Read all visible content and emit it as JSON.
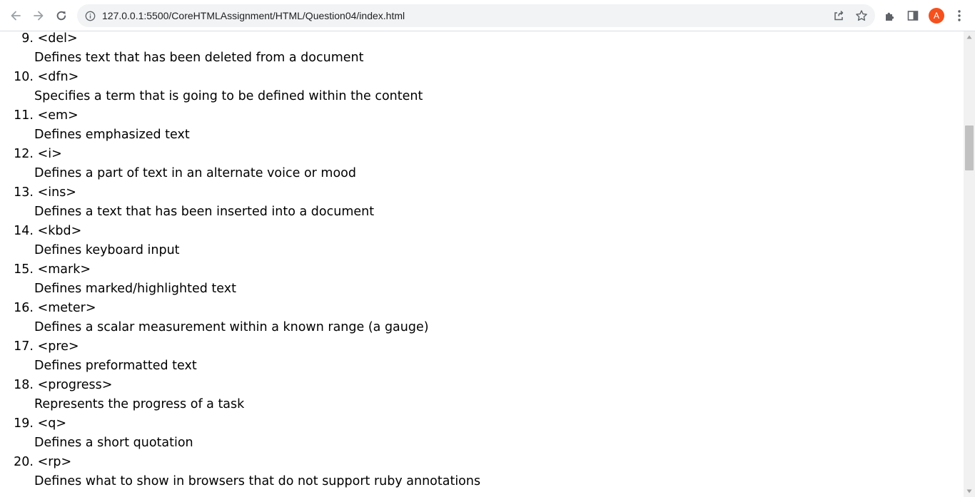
{
  "browser": {
    "url": "127.0.0.1:5500/CoreHTMLAssignment/HTML/Question04/index.html",
    "profile_initial": "A",
    "profile_color": "#f4511e",
    "icons": [
      "back-arrow-icon",
      "forward-arrow-icon",
      "reload-icon",
      "info-icon",
      "share-icon",
      "star-icon",
      "extensions-icon",
      "side-panel-icon",
      "kebab-menu-icon"
    ]
  },
  "entries": [
    {
      "number": "9.",
      "tag": "<del>",
      "description": "Defines text that has been deleted from a document"
    },
    {
      "number": "10.",
      "tag": "<dfn>",
      "description": "Specifies a term that is going to be defined within the content"
    },
    {
      "number": "11.",
      "tag": "<em>",
      "description": "Defines emphasized text"
    },
    {
      "number": "12.",
      "tag": "<i>",
      "description": "Defines a part of text in an alternate voice or mood"
    },
    {
      "number": "13.",
      "tag": "<ins>",
      "description": "Defines a text that has been inserted into a document"
    },
    {
      "number": "14.",
      "tag": "<kbd>",
      "description": "Defines keyboard input"
    },
    {
      "number": "15.",
      "tag": "<mark>",
      "description": "Defines marked/highlighted text"
    },
    {
      "number": "16.",
      "tag": "<meter>",
      "description": "Defines a scalar measurement within a known range (a gauge)"
    },
    {
      "number": "17.",
      "tag": "<pre>",
      "description": "Defines preformatted text"
    },
    {
      "number": "18.",
      "tag": "<progress>",
      "description": "Represents the progress of a task"
    },
    {
      "number": "19.",
      "tag": "<q>",
      "description": "Defines a short quotation"
    },
    {
      "number": "20.",
      "tag": "<rp>",
      "description": "Defines what to show in browsers that do not support ruby annotations"
    }
  ]
}
